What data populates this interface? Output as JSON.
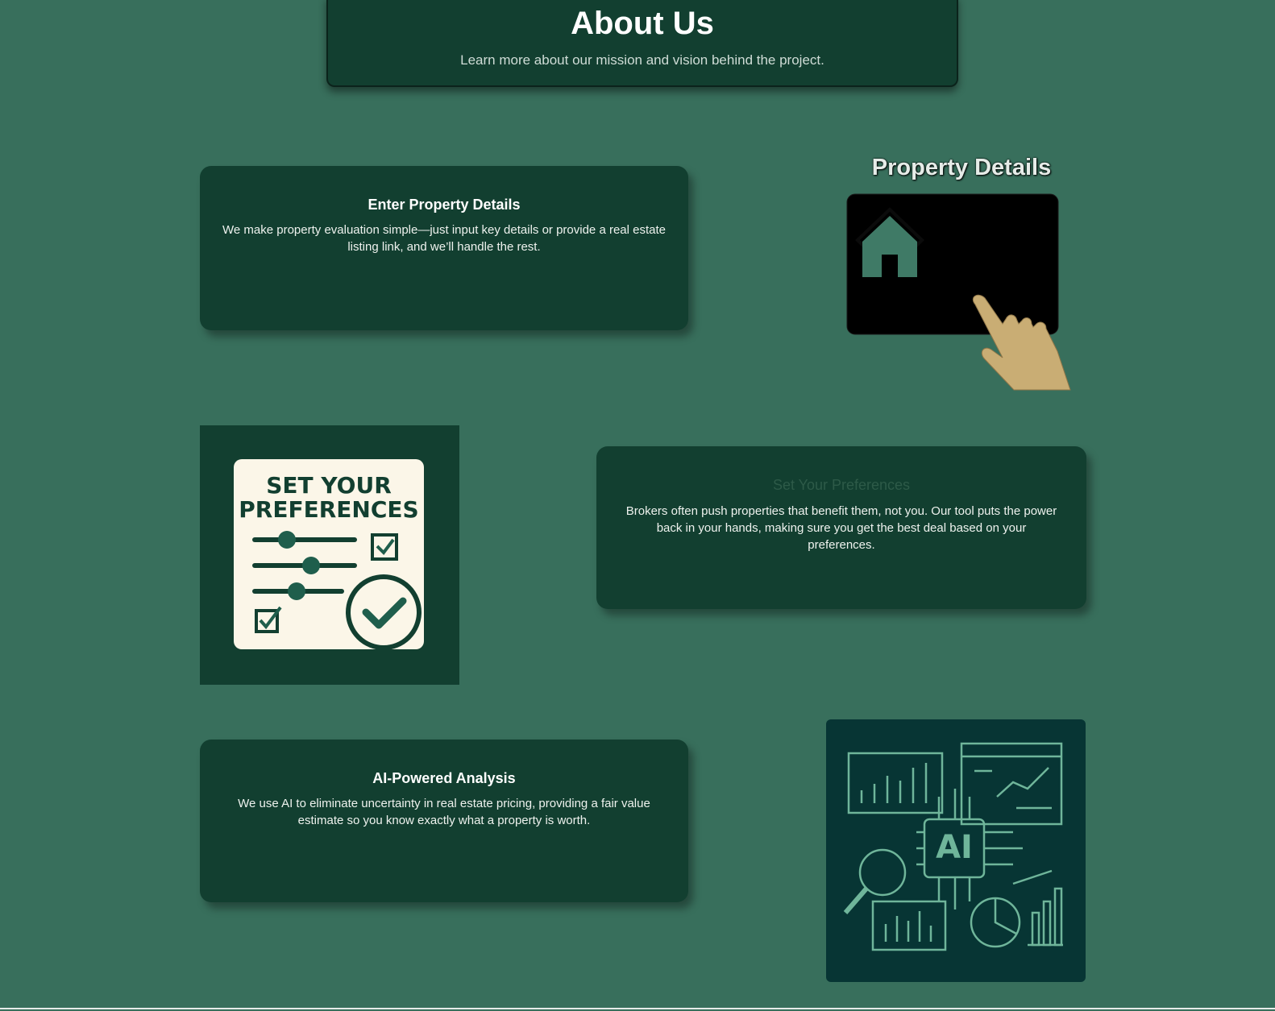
{
  "header": {
    "title": "About Us",
    "subtitle": "Learn more about our mission and vision behind the project."
  },
  "sections": [
    {
      "title": "Enter Property Details",
      "text": "We make property evaluation simple—just input key details or provide a real estate listing link, and we’ll handle the rest.",
      "illustration_title": "Property Details",
      "illustration_icon": "house-touchscreen-icon"
    },
    {
      "title": "Set Your Preferences",
      "text": "Brokers often push properties that benefit them, not you. Our tool puts the power back in your hands, making sure you get the best deal based on your preferences.",
      "illustration_title": "SET YOUR PREFERENCES",
      "illustration_icon": "preferences-checklist-icon"
    },
    {
      "title": "AI-Powered Analysis",
      "text": "We use AI to eliminate uncertainty in real estate pricing, providing a fair value estimate so you know exactly what a property is worth.",
      "illustration_title": "AI",
      "illustration_icon": "ai-analytics-icon"
    }
  ],
  "colors": {
    "background": "#386f5c",
    "card": "#123f30",
    "accent": "#1f5e4c",
    "cream": "#fbf6e8",
    "hand": "#c9ad74",
    "ai_panel": "#073534",
    "ai_lines": "#6fb59a"
  }
}
